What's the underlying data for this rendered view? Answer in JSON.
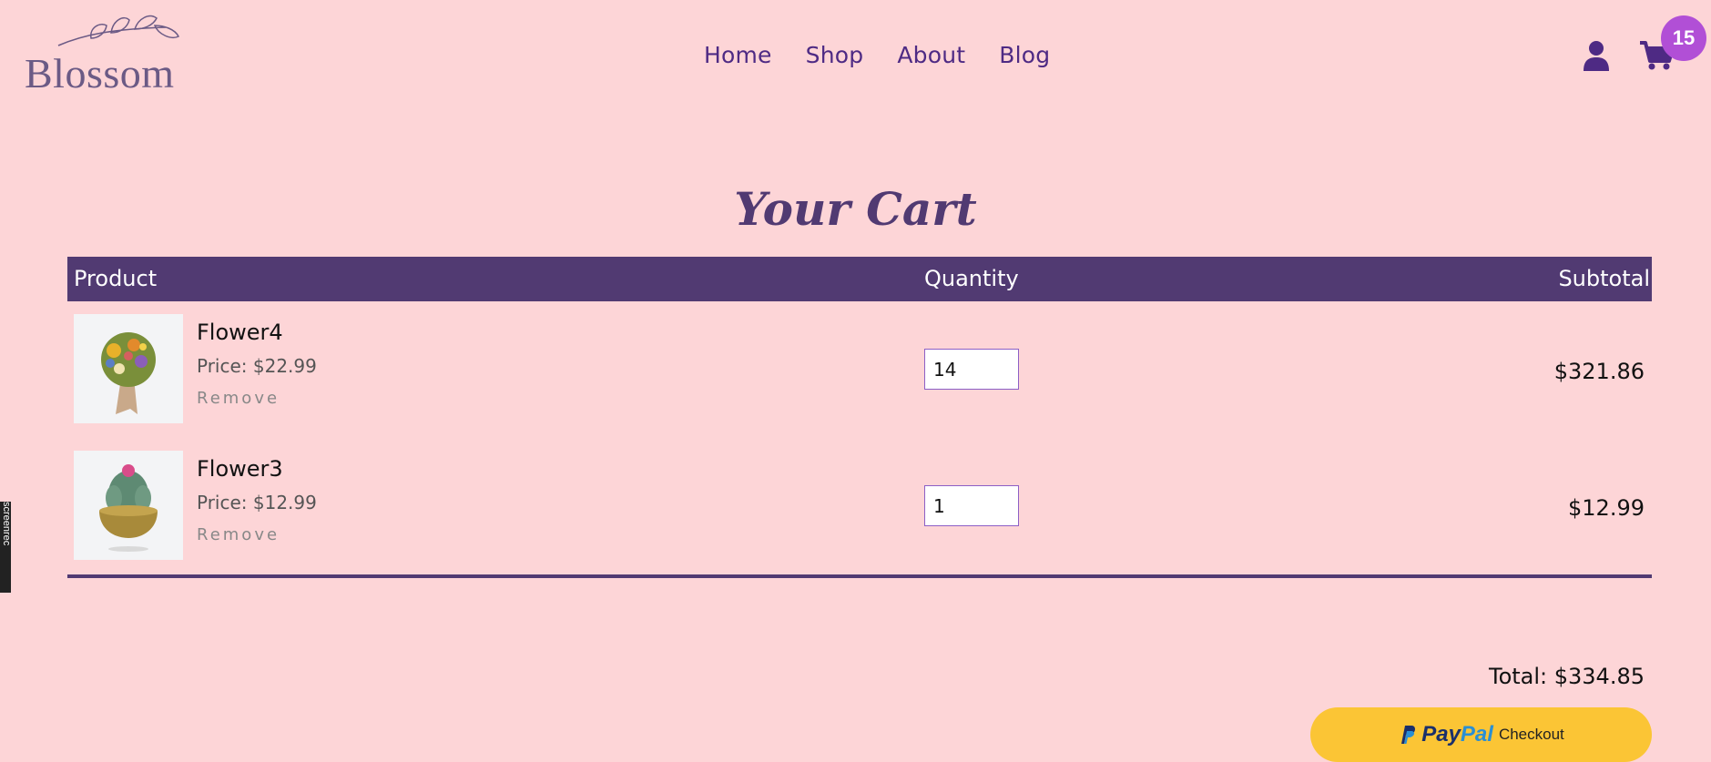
{
  "header": {
    "brand": "Blossom",
    "nav": [
      "Home",
      "Shop",
      "About",
      "Blog"
    ],
    "cart_count": "15",
    "user_icon": "user-icon",
    "cart_icon": "shopping-cart-icon"
  },
  "cart": {
    "title": "Your Cart",
    "columns": {
      "product": "Product",
      "quantity": "Quantity",
      "subtotal": "Subtotal"
    },
    "items": [
      {
        "name": "Flower4",
        "price": "Price: $22.99",
        "remove": "Remove",
        "quantity": "14",
        "subtotal": "$321.86"
      },
      {
        "name": "Flower3",
        "price": "Price: $12.99",
        "remove": "Remove",
        "quantity": "1",
        "subtotal": "$12.99"
      }
    ],
    "total": "Total: $334.85"
  },
  "checkout": {
    "paypal_pay": "Pay",
    "paypal_pal": "Pal",
    "label": "Checkout"
  },
  "overlay": {
    "watermark": "screenrec"
  },
  "colors": {
    "background": "#fdd5d7",
    "accent": "#513a72",
    "nav": "#4e2a84",
    "badge": "#b14fd6",
    "paypal": "#fbc535"
  }
}
